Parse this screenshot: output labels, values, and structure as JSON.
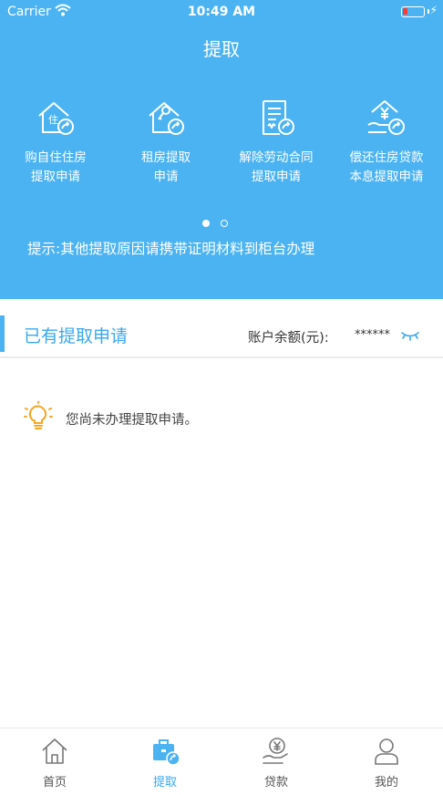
{
  "status_bar": {
    "carrier": "Carrier",
    "time": "10:49 AM"
  },
  "header": {
    "title": "提取"
  },
  "services": [
    {
      "icon": "house-pen-icon",
      "line1": "购自住住房",
      "line2": "提取申请"
    },
    {
      "icon": "house-key-icon",
      "line1": "租房提取",
      "line2": "申请"
    },
    {
      "icon": "contract-document-icon",
      "line1": "解除劳动合同",
      "line2": "提取申请"
    },
    {
      "icon": "yen-house-hand-icon",
      "line1": "偿还住房贷款",
      "line2": "本息提取申请"
    }
  ],
  "carousel": {
    "pages": 2,
    "active": 1
  },
  "hint": "提示:其他提取原因请携带证明材料到柜台办理",
  "applications": {
    "title": "已有提取申请",
    "balance_label": "账户余额(元):",
    "balance_value": "******",
    "empty_message": "您尚未办理提取申请。"
  },
  "tabbar": [
    {
      "label": "首页",
      "icon": "home-icon",
      "active": false
    },
    {
      "label": "提取",
      "icon": "briefcase-icon",
      "active": true
    },
    {
      "label": "贷款",
      "icon": "loan-hand-icon",
      "active": false
    },
    {
      "label": "我的",
      "icon": "user-icon",
      "active": false
    }
  ],
  "colors": {
    "primary": "#4cb3f2",
    "accent_text": "#3aa8ee",
    "bulb": "#f5a623"
  }
}
